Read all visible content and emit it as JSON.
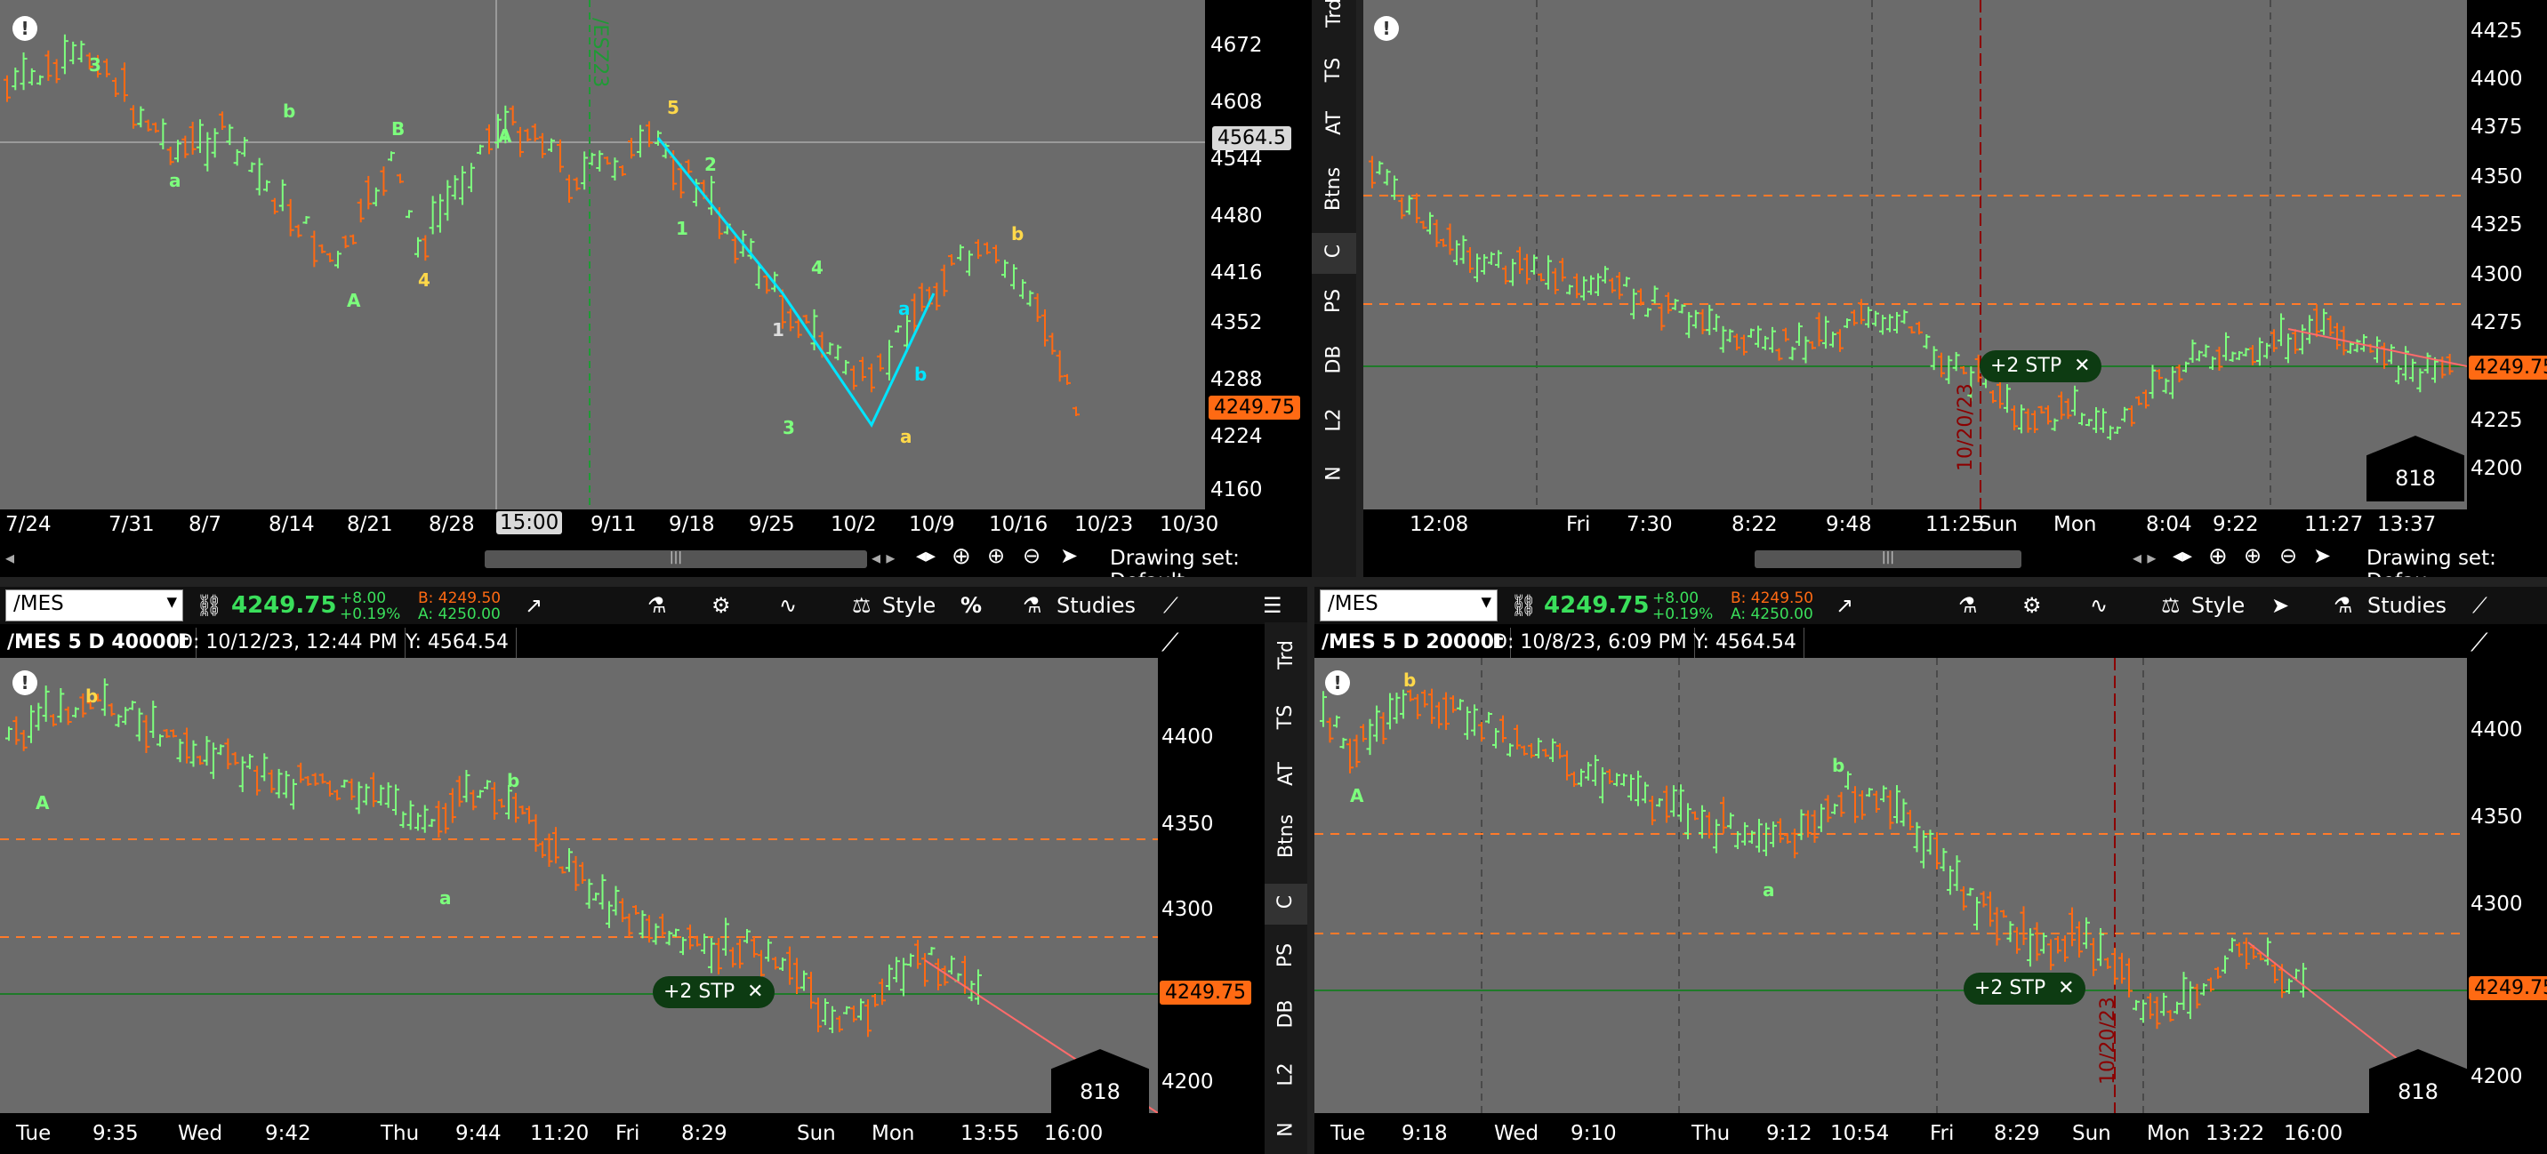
{
  "colors": {
    "up": "#7dff7d",
    "down": "#ff6a13",
    "panel": "#6b6b6b",
    "price_tag": "#ff6a13",
    "stop_line": "#1f7a29",
    "dash": "#ff7a2a",
    "wave_green": "#7dff7d",
    "wave_yellow": "#ffd84a",
    "trendline": "#00e5ff"
  },
  "tl": {
    "price_labels": [
      "4672",
      "4608",
      "4544",
      "4480",
      "4416",
      "4352",
      "4288",
      "4224",
      "4160"
    ],
    "crosshair_price": "4564.5",
    "last_price": "4249.75",
    "dates": [
      "7/24",
      "7/31",
      "8/7",
      "8/14",
      "8/21",
      "8/28",
      "15:00",
      "9/11",
      "9/18",
      "9/25",
      "10/2",
      "10/9",
      "10/16",
      "10/23",
      "10/30"
    ],
    "event_label": "/ESZ23",
    "drawing_set": "Drawing set: Default",
    "waves": [
      "a",
      "b",
      "B",
      "A",
      "4",
      "5",
      "2",
      "1",
      "4",
      "3",
      "a",
      "b",
      "1",
      "a",
      "b",
      "3",
      "A"
    ]
  },
  "sidebar_tabs": [
    "Trd",
    "TS",
    "AT",
    "Btns",
    "C",
    "PS",
    "DB",
    "L2",
    "N"
  ],
  "tr": {
    "price_labels": [
      "4425",
      "4400",
      "4375",
      "4350",
      "4325",
      "4300",
      "4275",
      "4250",
      "4225",
      "4200"
    ],
    "last_price": "4249.75",
    "times": [
      "12:08",
      "Fri",
      "7:30",
      "8:22",
      "9:48",
      "11:25",
      "Sun",
      "Mon",
      "8:04",
      "9:22",
      "11:27",
      "13:37"
    ],
    "date_marker": "10/20/23",
    "stop_label": "+2 STP",
    "volume": "818",
    "drawing_set": "Drawing set: Defau"
  },
  "bl": {
    "symbol": "/MES",
    "last": "4249.75",
    "change": "+8.00",
    "change_pct": "+0.19%",
    "bid": "B: 4249.50",
    "ask": "A: 4250.00",
    "style_label": "Style",
    "studies_label": "Studies",
    "title": "/MES 5 D 40000t",
    "date_info": "D: 10/12/23, 12:44 PM",
    "y_info": "Y: 4564.54",
    "price_labels": [
      "4400",
      "4350",
      "4300",
      "4250",
      "4200"
    ],
    "last_price": "4249.75",
    "times": [
      "Tue",
      "9:35",
      "Wed",
      "9:42",
      "Thu",
      "9:44",
      "11:20",
      "Fri",
      "8:29",
      "Sun",
      "Mon",
      "13:55",
      "16:00"
    ],
    "stop_label": "+2 STP",
    "volume": "818",
    "waves": [
      "b",
      "A",
      "b",
      "a"
    ]
  },
  "br": {
    "symbol": "/MES",
    "last": "4249.75",
    "change": "+8.00",
    "change_pct": "+0.19%",
    "bid": "B: 4249.50",
    "ask": "A: 4250.00",
    "style_label": "Style",
    "studies_label": "Studies",
    "title": "/MES 5 D 20000t",
    "date_info": "D: 10/8/23, 6:09 PM",
    "y_info": "Y: 4564.54",
    "price_labels": [
      "4400",
      "4350",
      "4300",
      "4250",
      "4200"
    ],
    "last_price": "4249.75",
    "times": [
      "Tue",
      "9:18",
      "Wed",
      "9:10",
      "Thu",
      "9:12",
      "10:54",
      "Fri",
      "8:29",
      "Sun",
      "Mon",
      "13:22",
      "16:00"
    ],
    "date_marker": "10/20/23",
    "stop_label": "+2 STP",
    "volume": "818",
    "waves": [
      "b",
      "A",
      "b",
      "a"
    ]
  }
}
